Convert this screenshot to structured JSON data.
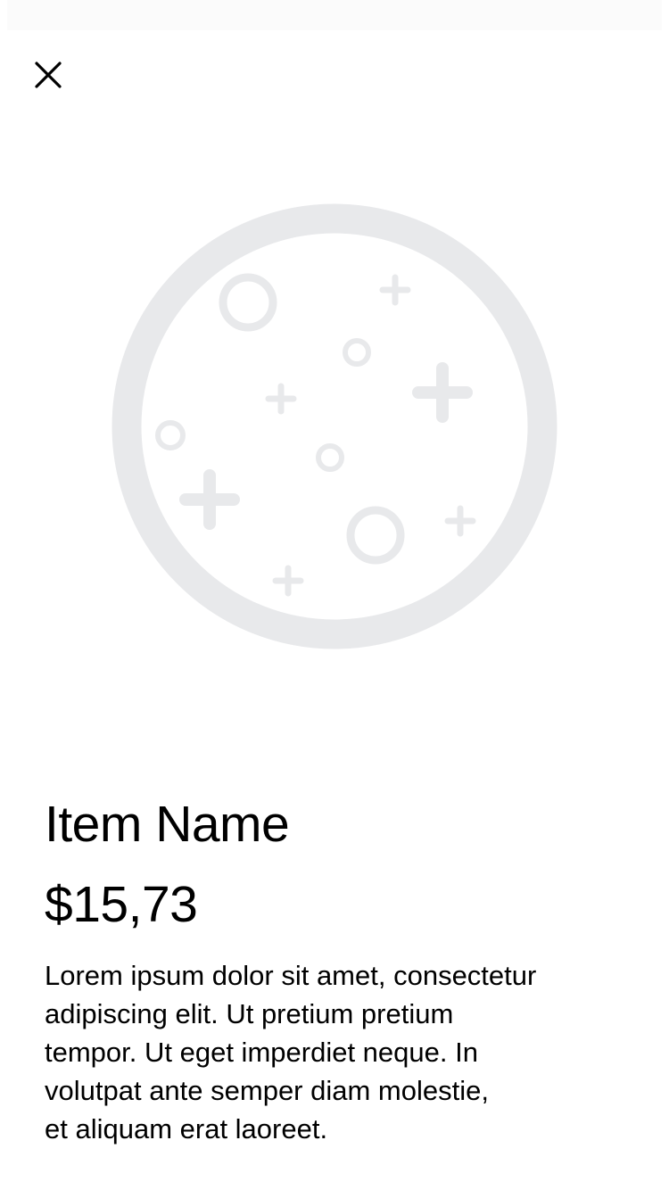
{
  "header": {
    "close_icon": "close-icon"
  },
  "product": {
    "image_placeholder_icon": "image-placeholder-icon",
    "name": "Item Name",
    "price": "$15,73",
    "description_lines": [
      "Lorem ipsum dolor sit amet, consectetur",
      "adipiscing elit. Ut pretium pretium",
      "tempor. Ut eget imperdiet neque. In",
      "volutpat ante semper diam molestie,",
      "et aliquam erat laoreet."
    ]
  },
  "colors": {
    "background": "#ffffff",
    "text": "#000000",
    "placeholder": "#e8e9eb"
  }
}
